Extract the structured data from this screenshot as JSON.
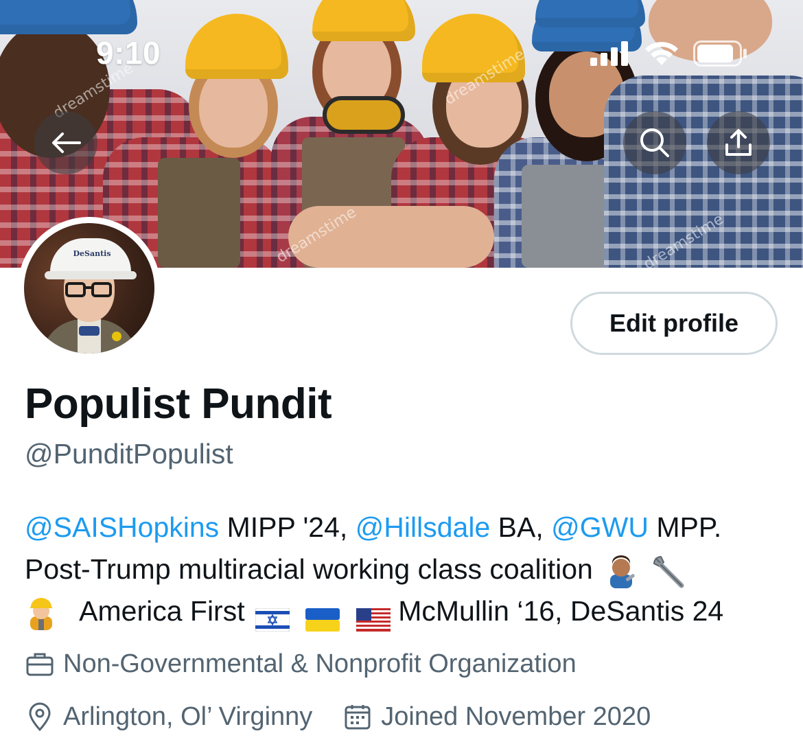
{
  "status_bar": {
    "time": "9:10",
    "icons": [
      "cellular-signal-icon",
      "wifi-icon",
      "battery-icon"
    ]
  },
  "header": {
    "back_icon": "back-arrow-icon",
    "search_icon": "search-icon",
    "share_icon": "share-icon",
    "banner_watermark": "dreamstime"
  },
  "avatar": {
    "hat_text": "DeSantis"
  },
  "profile": {
    "edit_label": "Edit profile",
    "display_name": "Populist Pundit",
    "handle": "@PunditPopulist"
  },
  "bio": {
    "mention_1": "@SAISHopkins",
    "text_1": " MIPP '24, ",
    "mention_2": "@Hillsdale",
    "text_2": " BA, ",
    "mention_3": "@GWU",
    "text_3": " MPP.",
    "line_2": "Post-Trump multiracial working class coalition",
    "line_3_a": "America First",
    "line_3_b": "McMullin ‘16, DeSantis 24"
  },
  "meta": {
    "category": "Non-Governmental & Nonprofit Organization",
    "location": "Arlington, Ol’ Virginny",
    "joined": "Joined November 2020"
  },
  "colors": {
    "link": "#1d9bf0",
    "secondary_text": "#536471",
    "primary_text": "#0f1419",
    "button_border": "#cfd9de"
  }
}
